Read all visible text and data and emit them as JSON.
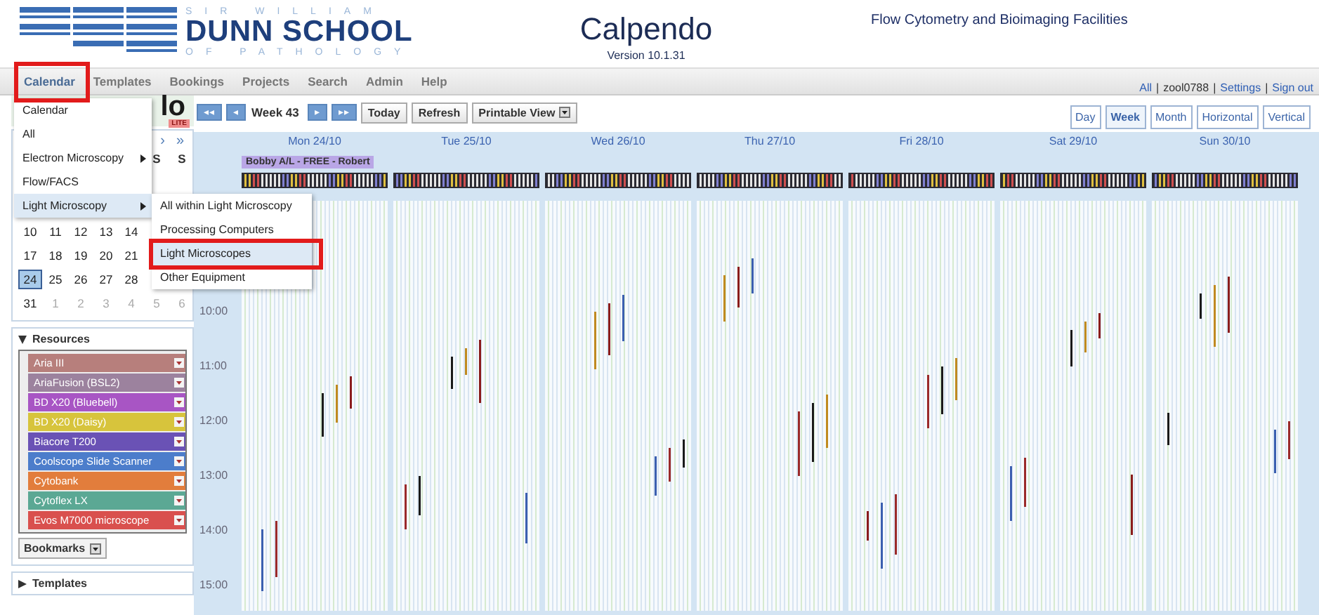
{
  "header": {
    "logo": {
      "top": "SIR WILLIAM",
      "main": "DUNN SCHOOL",
      "bottom": "OF PATHOLOGY"
    },
    "app_title": "Calpendo",
    "version": "Version 10.1.31",
    "facility": "Flow Cytometry and Bioimaging Facilities"
  },
  "menu_bar": {
    "items": [
      {
        "label": "Calendar",
        "selected": true
      },
      {
        "label": "Templates",
        "selected": false
      },
      {
        "label": "Bookings",
        "selected": false
      },
      {
        "label": "Projects",
        "selected": false
      },
      {
        "label": "Search",
        "selected": false
      },
      {
        "label": "Admin",
        "selected": false
      },
      {
        "label": "Help",
        "selected": false
      }
    ],
    "separator": "|",
    "user_links": [
      {
        "label": "All",
        "kind": "link"
      },
      {
        "label": "zool0788",
        "kind": "text"
      },
      {
        "label": "Settings",
        "kind": "link"
      },
      {
        "label": "Sign out",
        "kind": "link"
      }
    ]
  },
  "toolbar": {
    "nav_buttons": [
      "◂◂",
      "◂",
      "▸",
      "▸▸"
    ],
    "week_label": "Week 43",
    "buttons": [
      "Today",
      "Refresh"
    ],
    "printable_view": "Printable View",
    "views": [
      {
        "label": "Day",
        "selected": false
      },
      {
        "label": "Week",
        "selected": true
      },
      {
        "label": "Month",
        "selected": false
      },
      {
        "label": "Horizontal",
        "selected": false
      },
      {
        "label": "Vertical",
        "selected": false
      }
    ]
  },
  "sidebar": {
    "logo": "lo",
    "logo_badge": "LITE",
    "mini_calendar": {
      "nav": [
        "›",
        "»"
      ],
      "weekday_headers": [
        "S",
        "S"
      ],
      "weeks": [
        {
          "days": [
            {
              "label": "10",
              "other_month": false,
              "selected": false
            },
            {
              "label": "11",
              "other_month": false,
              "selected": false
            },
            {
              "label": "12",
              "other_month": false,
              "selected": false
            },
            {
              "label": "13",
              "other_month": false,
              "selected": false
            },
            {
              "label": "14",
              "other_month": false,
              "selected": false
            }
          ]
        },
        {
          "days": [
            {
              "label": "17",
              "other_month": false,
              "selected": false
            },
            {
              "label": "18",
              "other_month": false,
              "selected": false
            },
            {
              "label": "19",
              "other_month": false,
              "selected": false
            },
            {
              "label": "20",
              "other_month": false,
              "selected": false
            },
            {
              "label": "21",
              "other_month": false,
              "selected": false
            }
          ]
        },
        {
          "days": [
            {
              "label": "24",
              "other_month": false,
              "selected": true
            },
            {
              "label": "25",
              "other_month": false,
              "selected": false
            },
            {
              "label": "26",
              "other_month": false,
              "selected": false
            },
            {
              "label": "27",
              "other_month": false,
              "selected": false
            },
            {
              "label": "28",
              "other_month": false,
              "selected": false
            }
          ]
        },
        {
          "days": [
            {
              "label": "31",
              "other_month": false,
              "selected": false
            },
            {
              "label": "1",
              "other_month": true,
              "selected": false
            },
            {
              "label": "2",
              "other_month": true,
              "selected": false
            },
            {
              "label": "3",
              "other_month": true,
              "selected": false
            },
            {
              "label": "4",
              "other_month": true,
              "selected": false
            },
            {
              "label": "5",
              "other_month": true,
              "selected": false
            },
            {
              "label": "6",
              "other_month": true,
              "selected": false
            }
          ]
        }
      ]
    },
    "resources": {
      "title": "Resources",
      "expanded": true,
      "items": [
        {
          "name": "Aria III",
          "color": "#b77f7c"
        },
        {
          "name": "AriaFusion (BSL2)",
          "color": "#9c829e"
        },
        {
          "name": "BD X20 (Bluebell)",
          "color": "#a855c4"
        },
        {
          "name": "BD X20 (Daisy)",
          "color": "#d7c43c"
        },
        {
          "name": "Biacore T200",
          "color": "#6a52b5"
        },
        {
          "name": "Coolscope Slide Scanner",
          "color": "#4c7dcb"
        },
        {
          "name": "Cytobank",
          "color": "#e27d3c"
        },
        {
          "name": "Cytoflex LX",
          "color": "#5ba894"
        },
        {
          "name": "Evos M7000 microscope",
          "color": "#d9504e"
        }
      ],
      "bookmarks": "Bookmarks"
    },
    "templates": {
      "title": "Templates",
      "expanded": false
    }
  },
  "calendar": {
    "days": [
      {
        "label": "Mon 24/10",
        "bookings": [
          {
            "label": "Bobby A/L - FREE - Robert",
            "color": "#b9a6e6"
          }
        ]
      },
      {
        "label": "Tue 25/10"
      },
      {
        "label": "Wed 26/10"
      },
      {
        "label": "Thu 27/10"
      },
      {
        "label": "Fri 28/10"
      },
      {
        "label": "Sat 29/10"
      },
      {
        "label": "Sun 30/10"
      }
    ],
    "times": [
      "10:00",
      "11:00",
      "12:00",
      "13:00",
      "14:00",
      "15:00"
    ]
  },
  "dropdown": {
    "items": [
      {
        "label": "Calendar",
        "submenu": false,
        "highlighted": false
      },
      {
        "label": "All",
        "submenu": false,
        "highlighted": false
      },
      {
        "label": "Electron Microscopy",
        "submenu": true,
        "highlighted": false
      },
      {
        "label": "Flow/FACS",
        "submenu": false,
        "highlighted": false
      },
      {
        "label": "Light Microscopy",
        "submenu": true,
        "highlighted": true
      }
    ],
    "submenu": [
      {
        "label": "All within Light Microscopy",
        "highlighted": false
      },
      {
        "label": "Processing Computers",
        "highlighted": false
      },
      {
        "label": "Light Microscopes",
        "highlighted": true
      },
      {
        "label": "Other Equipment",
        "highlighted": false
      }
    ]
  }
}
